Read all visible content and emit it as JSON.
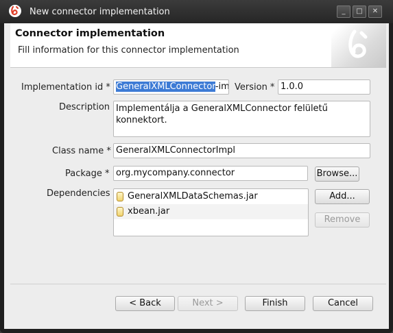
{
  "window": {
    "title": "New connector implementation",
    "controls": [
      "_",
      "□",
      "✕"
    ]
  },
  "header": {
    "title": "Connector implementation",
    "subtitle": "Fill information for this connector implementation"
  },
  "form": {
    "implementation_id_label": "Implementation id *",
    "implementation_id_selected": "GeneralXMLConnector",
    "implementation_id_rest": "-im",
    "version_label": "Version *",
    "version_value": "1.0.0",
    "description_label": "Description",
    "description_line1": "Implementálja a GeneralXMLConnector felületű",
    "description_line2": "konnektort.",
    "class_name_label": "Class name *",
    "class_name_value": "GeneralXMLConnectorImpl",
    "package_label": "Package *",
    "package_value": "org.mycompany.connector",
    "browse_label": "Browse...",
    "dependencies_label": "Dependencies",
    "dependencies": [
      {
        "name": "GeneralXMLDataSchemas.jar",
        "icon": "jar-icon"
      },
      {
        "name": "xbean.jar",
        "icon": "jar-icon"
      }
    ],
    "add_label": "Add...",
    "remove_label": "Remove"
  },
  "footer": {
    "back_label": "< Back",
    "next_label": "Next >",
    "finish_label": "Finish",
    "cancel_label": "Cancel"
  },
  "colors": {
    "selection": "#3d7bd5",
    "titlebar": "#2e2e2e",
    "dialog_bg": "#ededed",
    "logo": "#e0412b"
  }
}
